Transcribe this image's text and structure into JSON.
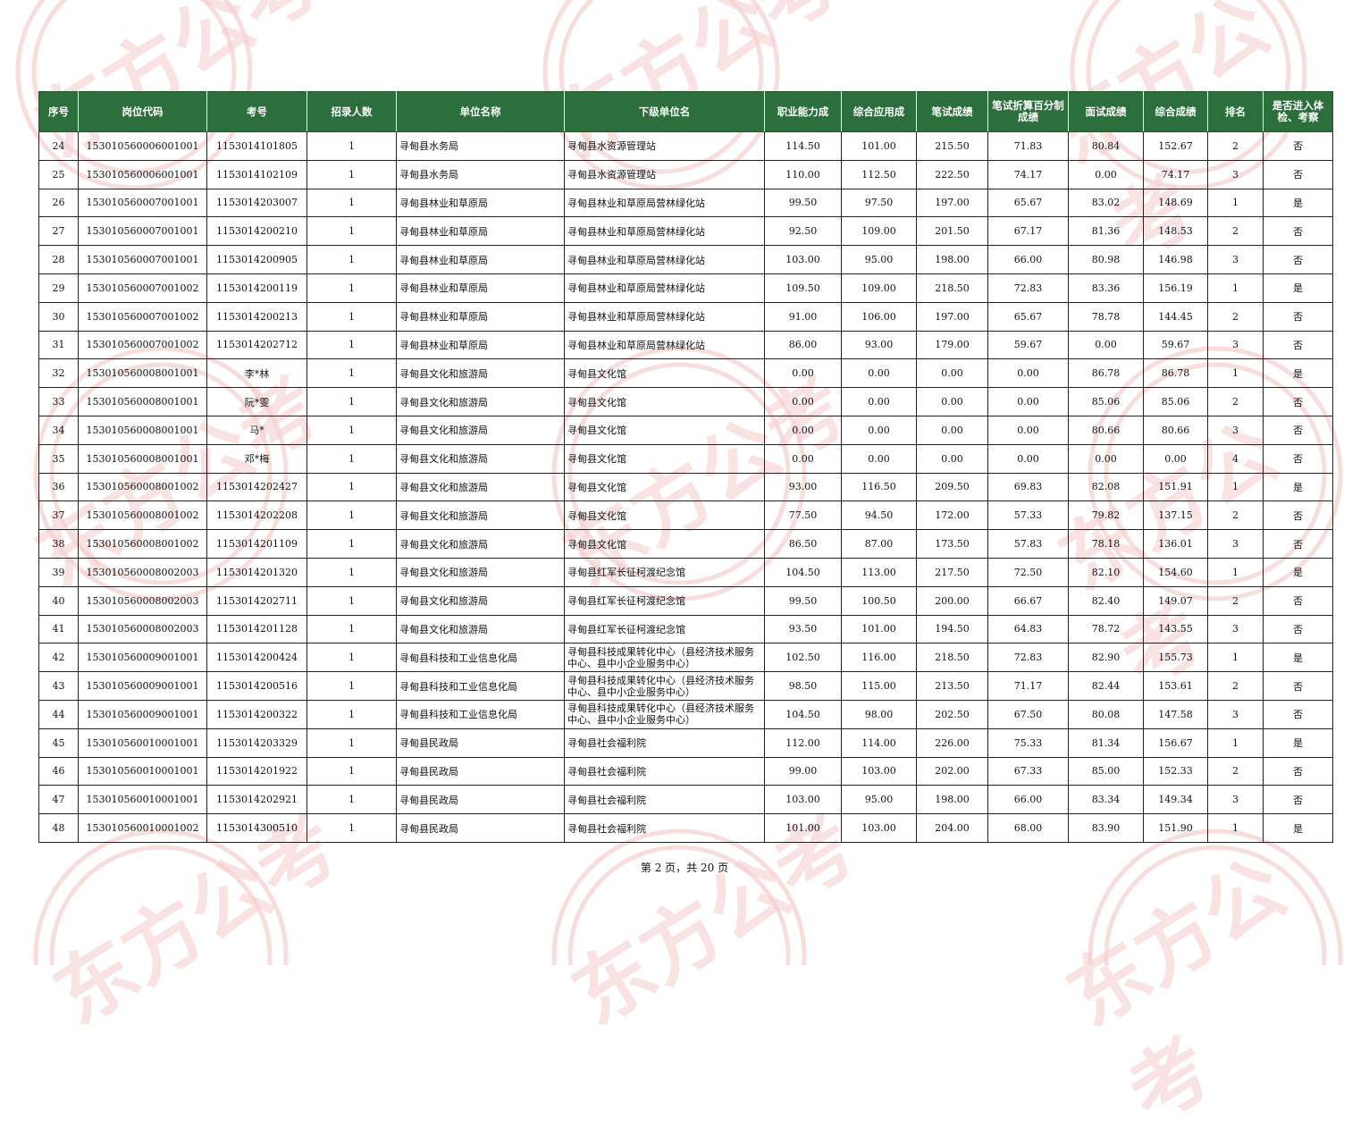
{
  "table": {
    "headers": [
      "序号",
      "岗位代码",
      "考号",
      "招录人数",
      "单位名称",
      "下级单位名",
      "职业能力成",
      "综合应用成",
      "笔试成绩",
      "笔试折算百分制成绩",
      "面试成绩",
      "综合成绩",
      "排名",
      "是否进入体检、考察"
    ],
    "rows": [
      [
        "24",
        "153010560006001001",
        "1153014101805",
        "1",
        "寻甸县水务局",
        "寻甸县水资源管理站",
        "114.50",
        "101.00",
        "215.50",
        "71.83",
        "80.84",
        "152.67",
        "2",
        "否"
      ],
      [
        "25",
        "153010560006001001",
        "1153014102109",
        "1",
        "寻甸县水务局",
        "寻甸县水资源管理站",
        "110.00",
        "112.50",
        "222.50",
        "74.17",
        "0.00",
        "74.17",
        "3",
        "否"
      ],
      [
        "26",
        "153010560007001001",
        "1153014203007",
        "1",
        "寻甸县林业和草原局",
        "寻甸县林业和草原局营林绿化站",
        "99.50",
        "97.50",
        "197.00",
        "65.67",
        "83.02",
        "148.69",
        "1",
        "是"
      ],
      [
        "27",
        "153010560007001001",
        "1153014200210",
        "1",
        "寻甸县林业和草原局",
        "寻甸县林业和草原局营林绿化站",
        "92.50",
        "109.00",
        "201.50",
        "67.17",
        "81.36",
        "148.53",
        "2",
        "否"
      ],
      [
        "28",
        "153010560007001001",
        "1153014200905",
        "1",
        "寻甸县林业和草原局",
        "寻甸县林业和草原局营林绿化站",
        "103.00",
        "95.00",
        "198.00",
        "66.00",
        "80.98",
        "146.98",
        "3",
        "否"
      ],
      [
        "29",
        "153010560007001002",
        "1153014200119",
        "1",
        "寻甸县林业和草原局",
        "寻甸县林业和草原局营林绿化站",
        "109.50",
        "109.00",
        "218.50",
        "72.83",
        "83.36",
        "156.19",
        "1",
        "是"
      ],
      [
        "30",
        "153010560007001002",
        "1153014200213",
        "1",
        "寻甸县林业和草原局",
        "寻甸县林业和草原局营林绿化站",
        "91.00",
        "106.00",
        "197.00",
        "65.67",
        "78.78",
        "144.45",
        "2",
        "否"
      ],
      [
        "31",
        "153010560007001002",
        "1153014202712",
        "1",
        "寻甸县林业和草原局",
        "寻甸县林业和草原局营林绿化站",
        "86.00",
        "93.00",
        "179.00",
        "59.67",
        "0.00",
        "59.67",
        "3",
        "否"
      ],
      [
        "32",
        "153010560008001001",
        "李*林",
        "1",
        "寻甸县文化和旅游局",
        "寻甸县文化馆",
        "0.00",
        "0.00",
        "0.00",
        "0.00",
        "86.78",
        "86.78",
        "1",
        "是"
      ],
      [
        "33",
        "153010560008001001",
        "阮*雯",
        "1",
        "寻甸县文化和旅游局",
        "寻甸县文化馆",
        "0.00",
        "0.00",
        "0.00",
        "0.00",
        "85.06",
        "85.06",
        "2",
        "否"
      ],
      [
        "34",
        "153010560008001001",
        "马*",
        "1",
        "寻甸县文化和旅游局",
        "寻甸县文化馆",
        "0.00",
        "0.00",
        "0.00",
        "0.00",
        "80.66",
        "80.66",
        "3",
        "否"
      ],
      [
        "35",
        "153010560008001001",
        "邓*梅",
        "1",
        "寻甸县文化和旅游局",
        "寻甸县文化馆",
        "0.00",
        "0.00",
        "0.00",
        "0.00",
        "0.00",
        "0.00",
        "4",
        "否"
      ],
      [
        "36",
        "153010560008001002",
        "1153014202427",
        "1",
        "寻甸县文化和旅游局",
        "寻甸县文化馆",
        "93.00",
        "116.50",
        "209.50",
        "69.83",
        "82.08",
        "151.91",
        "1",
        "是"
      ],
      [
        "37",
        "153010560008001002",
        "1153014202208",
        "1",
        "寻甸县文化和旅游局",
        "寻甸县文化馆",
        "77.50",
        "94.50",
        "172.00",
        "57.33",
        "79.82",
        "137.15",
        "2",
        "否"
      ],
      [
        "38",
        "153010560008001002",
        "1153014201109",
        "1",
        "寻甸县文化和旅游局",
        "寻甸县文化馆",
        "86.50",
        "87.00",
        "173.50",
        "57.83",
        "78.18",
        "136.01",
        "3",
        "否"
      ],
      [
        "39",
        "153010560008002003",
        "1153014201320",
        "1",
        "寻甸县文化和旅游局",
        "寻甸县红军长征柯渡纪念馆",
        "104.50",
        "113.00",
        "217.50",
        "72.50",
        "82.10",
        "154.60",
        "1",
        "是"
      ],
      [
        "40",
        "153010560008002003",
        "1153014202711",
        "1",
        "寻甸县文化和旅游局",
        "寻甸县红军长征柯渡纪念馆",
        "99.50",
        "100.50",
        "200.00",
        "66.67",
        "82.40",
        "149.07",
        "2",
        "否"
      ],
      [
        "41",
        "153010560008002003",
        "1153014201128",
        "1",
        "寻甸县文化和旅游局",
        "寻甸县红军长征柯渡纪念馆",
        "93.50",
        "101.00",
        "194.50",
        "64.83",
        "78.72",
        "143.55",
        "3",
        "否"
      ],
      [
        "42",
        "153010560009001001",
        "1153014200424",
        "1",
        "寻甸县科技和工业信息化局",
        "寻甸县科技成果转化中心（县经济技术服务中心、县中小企业服务中心）",
        "102.50",
        "116.00",
        "218.50",
        "72.83",
        "82.90",
        "155.73",
        "1",
        "是"
      ],
      [
        "43",
        "153010560009001001",
        "1153014200516",
        "1",
        "寻甸县科技和工业信息化局",
        "寻甸县科技成果转化中心（县经济技术服务中心、县中小企业服务中心）",
        "98.50",
        "115.00",
        "213.50",
        "71.17",
        "82.44",
        "153.61",
        "2",
        "否"
      ],
      [
        "44",
        "153010560009001001",
        "1153014200322",
        "1",
        "寻甸县科技和工业信息化局",
        "寻甸县科技成果转化中心（县经济技术服务中心、县中小企业服务中心）",
        "104.50",
        "98.00",
        "202.50",
        "67.50",
        "80.08",
        "147.58",
        "3",
        "否"
      ],
      [
        "45",
        "153010560010001001",
        "1153014203329",
        "1",
        "寻甸县民政局",
        "寻甸县社会福利院",
        "112.00",
        "114.00",
        "226.00",
        "75.33",
        "81.34",
        "156.67",
        "1",
        "是"
      ],
      [
        "46",
        "153010560010001001",
        "1153014201922",
        "1",
        "寻甸县民政局",
        "寻甸县社会福利院",
        "99.00",
        "103.00",
        "202.00",
        "67.33",
        "85.00",
        "152.33",
        "2",
        "否"
      ],
      [
        "47",
        "153010560010001001",
        "1153014202921",
        "1",
        "寻甸县民政局",
        "寻甸县社会福利院",
        "103.00",
        "95.00",
        "198.00",
        "66.00",
        "83.34",
        "149.34",
        "3",
        "否"
      ],
      [
        "48",
        "153010560010001002",
        "1153014300510",
        "1",
        "寻甸县民政局",
        "寻甸县社会福利院",
        "101.00",
        "103.00",
        "204.00",
        "68.00",
        "83.90",
        "151.90",
        "1",
        "是"
      ]
    ]
  },
  "watermark": {
    "text": "东方公考",
    "color": "#f3c4c4"
  },
  "footer": {
    "page_label": "第 2 页，共 20 页"
  }
}
